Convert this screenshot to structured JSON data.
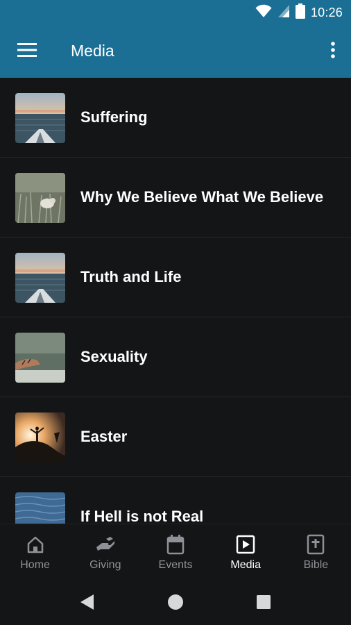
{
  "status_bar": {
    "time": "10:26"
  },
  "app_bar": {
    "title": "Media"
  },
  "media_items": [
    {
      "title": "Suffering",
      "thumbnail": "kayak-lake"
    },
    {
      "title": "Why We Believe What We Believe",
      "thumbnail": "lamb-in-grass"
    },
    {
      "title": "Truth and Life",
      "thumbnail": "kayak-lake"
    },
    {
      "title": "Sexuality",
      "thumbnail": "hands-over-water"
    },
    {
      "title": "Easter",
      "thumbnail": "silhouette-sunset"
    },
    {
      "title": "If Hell is not Real",
      "thumbnail": "blue-sea"
    }
  ],
  "bottom_nav": [
    {
      "label": "Home",
      "icon": "home-icon",
      "active": false
    },
    {
      "label": "Giving",
      "icon": "giving-hand-icon",
      "active": false
    },
    {
      "label": "Events",
      "icon": "calendar-icon",
      "active": false
    },
    {
      "label": "Media",
      "icon": "play-box-icon",
      "active": true
    },
    {
      "label": "Bible",
      "icon": "bible-icon",
      "active": false
    }
  ],
  "colors": {
    "accent": "#1b6f95",
    "background": "#141517",
    "divider": "#242629",
    "inactive": "#8e9196"
  }
}
